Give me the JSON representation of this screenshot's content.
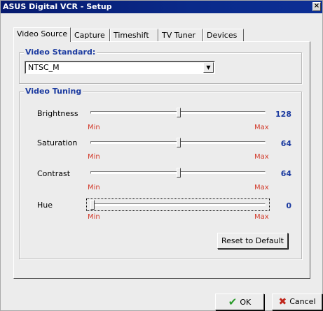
{
  "window": {
    "title": "ASUS Digital VCR - Setup",
    "close_glyph": "×"
  },
  "tabs": [
    {
      "label": "Video Source",
      "active": true
    },
    {
      "label": "Capture",
      "active": false
    },
    {
      "label": "Timeshift",
      "active": false
    },
    {
      "label": "TV Tuner",
      "active": false
    },
    {
      "label": "Devices",
      "active": false
    }
  ],
  "video_standard": {
    "title": "Video Standard:",
    "selected": "NTSC_M",
    "dropdown_glyph": "▼"
  },
  "video_tuning": {
    "title": "Video Tuning",
    "min_label": "Min",
    "max_label": "Max",
    "sliders": [
      {
        "label": "Brightness",
        "value": "128",
        "fraction": 0.5
      },
      {
        "label": "Saturation",
        "value": "64",
        "fraction": 0.5
      },
      {
        "label": "Contrast",
        "value": "64",
        "fraction": 0.5
      },
      {
        "label": "Hue",
        "value": "0",
        "fraction": 0.0
      }
    ],
    "reset_label": "Reset to Default"
  },
  "footer": {
    "ok_label": "OK",
    "cancel_label": "Cancel",
    "ok_icon": "checkmark-icon",
    "cancel_icon": "x-icon"
  },
  "colors": {
    "title_bar": "#0a2a8a",
    "group_title": "#1c3ba0",
    "min_max": "#d23a2a",
    "ok_icon": "#2a9b2a",
    "cancel_icon": "#c0261b"
  }
}
